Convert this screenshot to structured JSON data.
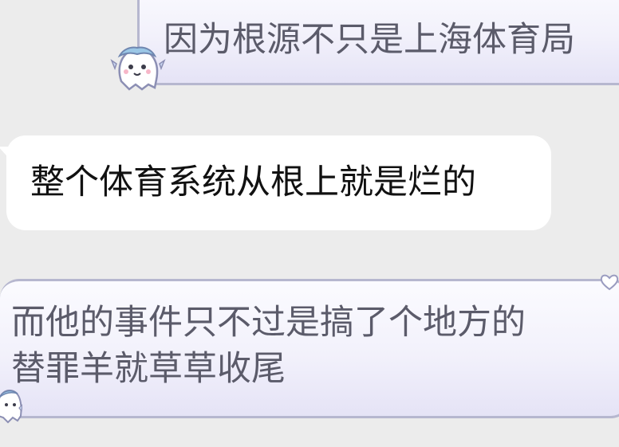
{
  "chat": {
    "messages": [
      {
        "text": "因为根源不只是上海体育局",
        "style": "theme"
      },
      {
        "text": "整个体育系统从根上就是烂的",
        "style": "plain"
      },
      {
        "lines": [
          "而他的事件只不过是搞了个地方的",
          "替罪羊就草草收尾"
        ],
        "style": "theme"
      }
    ]
  },
  "colors": {
    "background": "#ececec",
    "theme_border": "#b6b7cf",
    "theme_text": "#5b5b6a",
    "plain_text": "#111111"
  },
  "icons": {
    "bubble_decoration": "ghost-mascot-icon",
    "corner_decoration": "heart-icon"
  }
}
